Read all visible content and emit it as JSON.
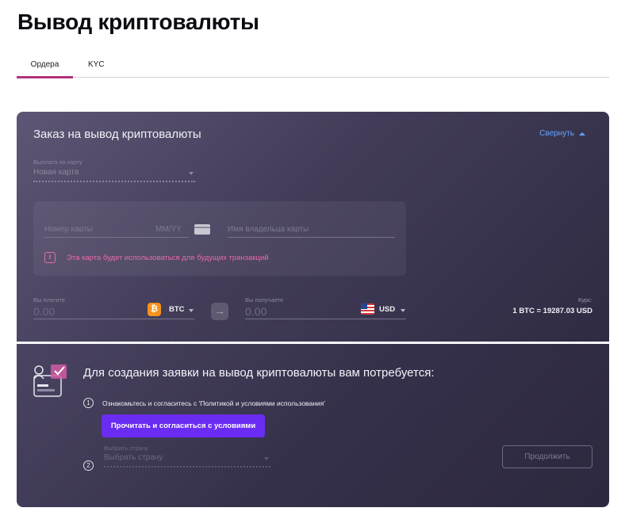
{
  "page": {
    "title": "Вывод криптовалюты"
  },
  "tabs": [
    {
      "label": "Ордера",
      "active": true
    },
    {
      "label": "KYC",
      "active": false
    }
  ],
  "order": {
    "title": "Заказ на вывод криптовалюты",
    "collapse_label": "Свернуть",
    "payout": {
      "label": "Выплата на карту",
      "value": "Новая карта"
    },
    "card": {
      "number_placeholder": "Номер карты",
      "expiry_placeholder": "MM/YY",
      "holder_placeholder": "Имя владельца карты",
      "info_icon": "i",
      "info_text": "Эта карта будет использоваться для будущих транзакций"
    },
    "pay": {
      "label": "Вы платите",
      "amount": "0.00",
      "currency": "BTC",
      "currency_icon": "₿"
    },
    "receive": {
      "label": "Вы получаете",
      "amount": "0.00",
      "currency": "USD"
    },
    "rate": {
      "label": "Курс:",
      "value": "1 BTC = 19287.03 USD"
    }
  },
  "requirements": {
    "title": "Для создания заявки на вывод криптовалюты вам потребуется:",
    "steps": [
      {
        "number": "1",
        "text": "Ознакомьтесь и согласитесь с 'Политикой и условиями использования'",
        "button_label": "Прочитать и согласиться с условиями"
      },
      {
        "number": "2",
        "field_label": "Выбрать страну",
        "field_value": "Выбрать страну"
      }
    ],
    "continue_label": "Продолжить"
  },
  "colors": {
    "accent_purple": "#6a2cf2",
    "tab_underline": "#b5317d",
    "link_blue": "#63a6ff",
    "info_pink": "#ea6aa8",
    "btc_orange": "#f7931a"
  }
}
